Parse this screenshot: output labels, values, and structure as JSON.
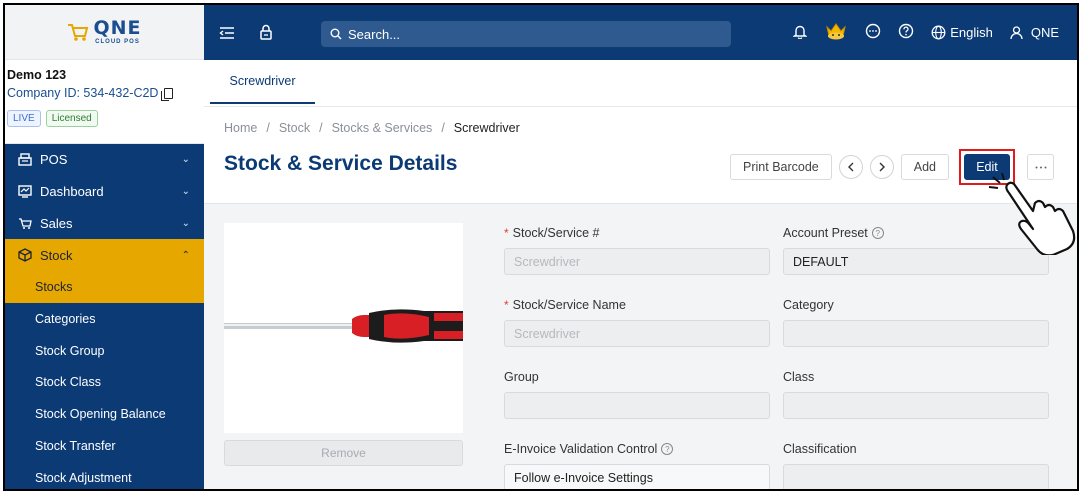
{
  "brand": {
    "logo_text": "QNE",
    "logo_sub": "CLOUD POS"
  },
  "company": {
    "name": "Demo 123",
    "id_label": "Company ID: 534-432-C2D",
    "badges": [
      "LIVE",
      "Licensed"
    ]
  },
  "sidebar": {
    "items": [
      {
        "label": "POS",
        "icon": "pos-icon"
      },
      {
        "label": "Dashboard",
        "icon": "dashboard-icon"
      },
      {
        "label": "Sales",
        "icon": "sales-icon"
      },
      {
        "label": "Stock",
        "icon": "stock-icon"
      }
    ],
    "stock_sub_items": [
      "Stocks",
      "Categories",
      "Stock Group",
      "Stock Class",
      "Stock Opening Balance",
      "Stock Transfer",
      "Stock Adjustment"
    ]
  },
  "topbar": {
    "search_placeholder": "Search...",
    "language": "English",
    "user": "QNE"
  },
  "tabs": [
    "Screwdriver"
  ],
  "breadcrumb": [
    "Home",
    "Stock",
    "Stocks & Services",
    "Screwdriver"
  ],
  "page_title": "Stock & Service Details",
  "actions": {
    "print_barcode": "Print Barcode",
    "add": "Add",
    "edit": "Edit"
  },
  "image": {
    "remove_label": "Remove"
  },
  "form": {
    "stock_no": {
      "label": "Stock/Service #",
      "placeholder": "Screwdriver"
    },
    "account_preset": {
      "label": "Account Preset",
      "value": "DEFAULT"
    },
    "stock_name": {
      "label": "Stock/Service Name",
      "placeholder": "Screwdriver"
    },
    "category": {
      "label": "Category",
      "value": ""
    },
    "group": {
      "label": "Group",
      "value": ""
    },
    "class": {
      "label": "Class",
      "value": ""
    },
    "einvoice": {
      "label": "E-Invoice Validation Control",
      "value": "Follow e-Invoice Settings"
    },
    "classification": {
      "label": "Classification",
      "value": ""
    }
  },
  "colors": {
    "navy": "#0b3a75",
    "accent": "#e6a700",
    "highlight": "#e11b1b"
  }
}
